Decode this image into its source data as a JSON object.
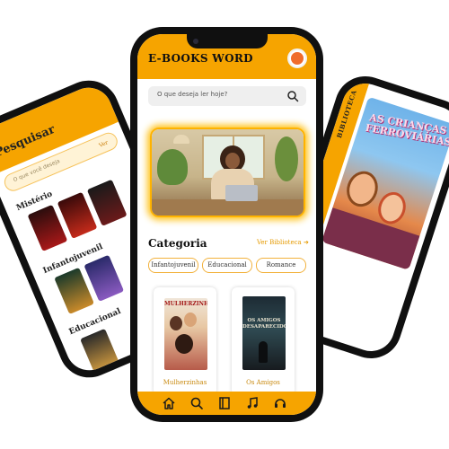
{
  "left_phone": {
    "title": "Pesquisar",
    "search_placeholder": "O que você deseja",
    "see_all": "Ver",
    "sections": [
      "Mistério",
      "Infantojuvenil",
      "Educacional"
    ]
  },
  "right_phone": {
    "side_label": "BIBLIOTECA",
    "cover_title": "AS CRIANÇAS FERROVIÁRIAS"
  },
  "app": {
    "title": "E-BOOKS WORD",
    "search_placeholder": "O que deseja ler hoje?",
    "category_title": "Categoria",
    "see_library": "Ver Biblioteca ➔",
    "chips": [
      "Infantojuvenil",
      "Educacional",
      "Romance"
    ],
    "books": [
      {
        "cover_title": "MULHERZINHAS",
        "label": "Mulherzinhas"
      },
      {
        "cover_title": "OS AMIGOS DESAPARECIDOS",
        "label": "Os Amigos"
      }
    ],
    "nav": [
      "home-icon",
      "search-icon",
      "library-icon",
      "music-icon",
      "support-icon"
    ]
  },
  "colors": {
    "accent": "#f6a400",
    "phone_frame": "#101010"
  }
}
